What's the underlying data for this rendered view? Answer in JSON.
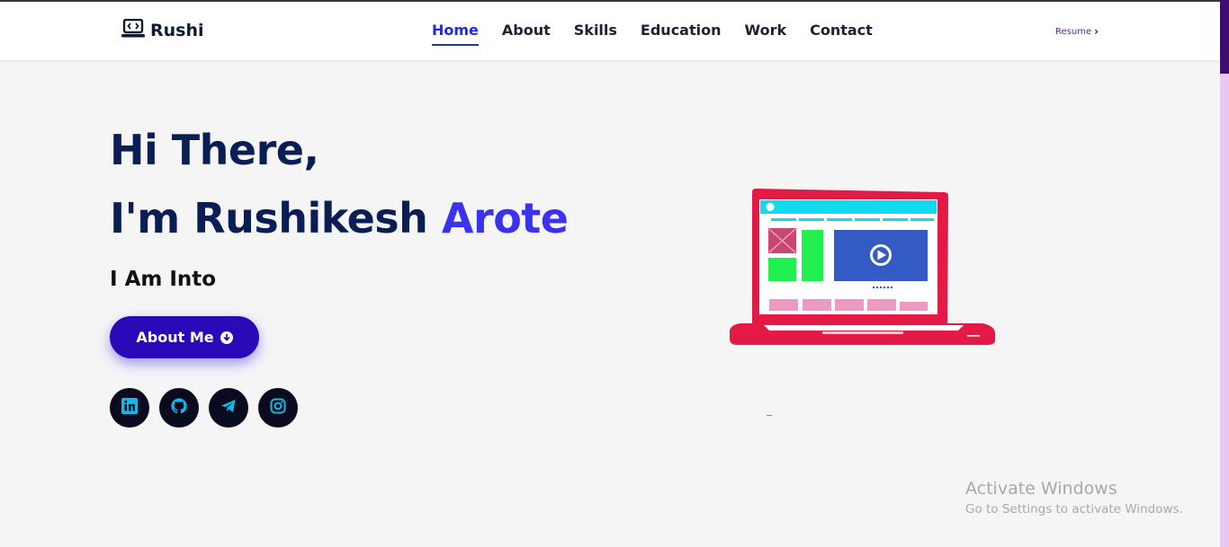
{
  "header": {
    "logo_text": "Rushi",
    "nav": [
      {
        "label": "Home",
        "active": true
      },
      {
        "label": "About"
      },
      {
        "label": "Skills"
      },
      {
        "label": "Education"
      },
      {
        "label": "Work"
      },
      {
        "label": "Contact"
      }
    ],
    "resume_label": "Resume"
  },
  "hero": {
    "greeting": "Hi There,",
    "name_prefix": "I'm Rushikesh ",
    "name_accent": "Arote",
    "into": "I Am Into",
    "about_button": "About Me",
    "socials": [
      {
        "icon": "linkedin-icon"
      },
      {
        "icon": "github-icon"
      },
      {
        "icon": "telegram-icon"
      },
      {
        "icon": "instagram-icon"
      }
    ]
  },
  "watermark": {
    "title": "Activate Windows",
    "subtitle": "Go to Settings to activate Windows."
  },
  "colors": {
    "primary": "#0b1d55",
    "accent": "#3b32f0",
    "button": "#2a0ab8",
    "nav_active": "#1f2be0",
    "social_bg": "#0b0b1f",
    "social_icon": "#14b8e6"
  }
}
